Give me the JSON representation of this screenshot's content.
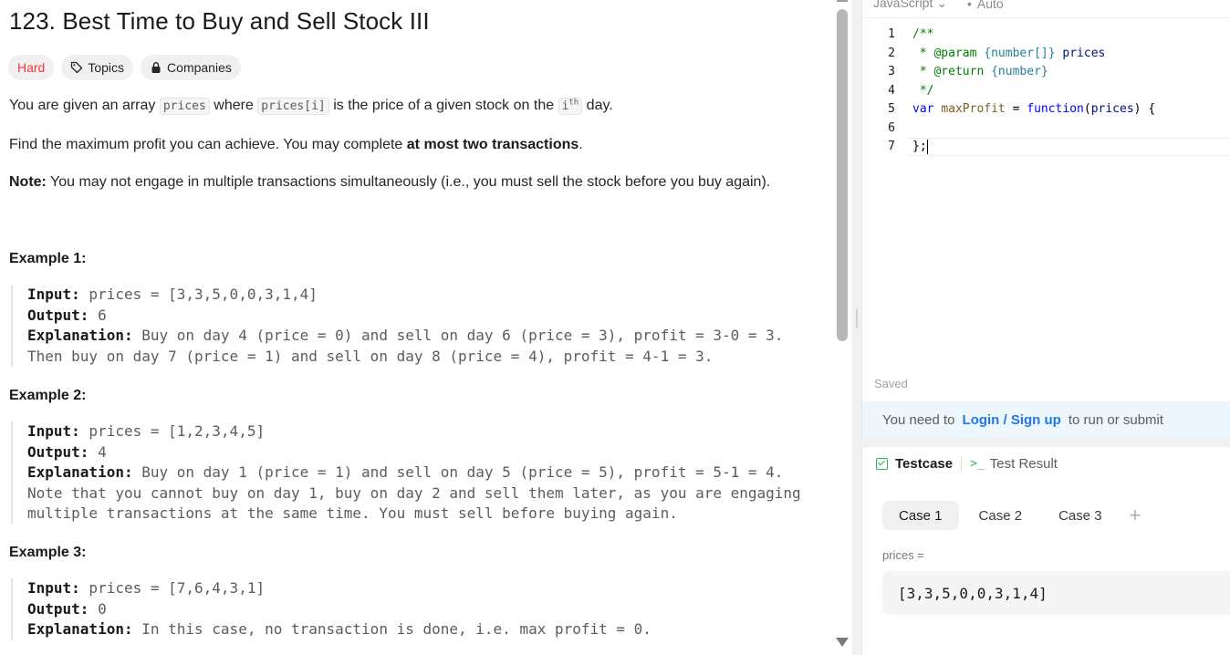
{
  "problem": {
    "title": "123. Best Time to Buy and Sell Stock III",
    "difficulty": "Hard",
    "topics_label": "Topics",
    "companies_label": "Companies",
    "p1": {
      "pre": "You are given an array ",
      "code1": "prices",
      "mid": " where ",
      "code2": "prices[i]",
      "mid2": " is the price of a given stock on the ",
      "code3": "i",
      "sup": "th",
      "post": " day."
    },
    "p2": {
      "pre": "Find the maximum profit you can achieve. You may complete ",
      "bold": "at most two transactions",
      "post": "."
    },
    "p3": {
      "bold": "Note:",
      "text": " You may not engage in multiple transactions simultaneously (i.e., you must sell the stock before you buy again)."
    },
    "examples": [
      {
        "heading": "Example 1:",
        "input_label": "Input:",
        "input": " prices = [3,3,5,0,0,3,1,4]",
        "output_label": "Output:",
        "output": " 6",
        "explanation_label": "Explanation:",
        "explanation": " Buy on day 4 (price = 0) and sell on day 6 (price = 3), profit = 3-0 = 3.",
        "explanation_extra": [
          "Then buy on day 7 (price = 1) and sell on day 8 (price = 4), profit = 4-1 = 3."
        ]
      },
      {
        "heading": "Example 2:",
        "input_label": "Input:",
        "input": " prices = [1,2,3,4,5]",
        "output_label": "Output:",
        "output": " 4",
        "explanation_label": "Explanation:",
        "explanation": " Buy on day 1 (price = 1) and sell on day 5 (price = 5), profit = 5-1 = 4.",
        "explanation_extra": [
          "Note that you cannot buy on day 1, buy on day 2 and sell them later, as you are engaging",
          "multiple transactions at the same time. You must sell before buying again."
        ]
      },
      {
        "heading": "Example 3:",
        "input_label": "Input:",
        "input": " prices = [7,6,4,3,1]",
        "output_label": "Output:",
        "output": " 0",
        "explanation_label": "Explanation:",
        "explanation": " In this case, no transaction is done, i.e. max profit = 0.",
        "explanation_extra": []
      }
    ]
  },
  "editor": {
    "language": "JavaScript",
    "mode": "Auto",
    "line_numbers": [
      "1",
      "2",
      "3",
      "4",
      "5",
      "6",
      "7"
    ],
    "saved_label": "Saved",
    "login_pre": "You need to",
    "login_link": "Login / Sign up",
    "login_post": "to run or submit"
  },
  "testcase": {
    "tab_testcase": "Testcase",
    "tab_result": "Test Result",
    "cases": [
      "Case 1",
      "Case 2",
      "Case 3"
    ],
    "add": "+",
    "var_label": "prices =",
    "var_value": "[3,3,5,0,0,3,1,4]"
  },
  "colors": {
    "hard": "#f63636",
    "link": "#1e7ae6",
    "success": "#2db55d"
  }
}
